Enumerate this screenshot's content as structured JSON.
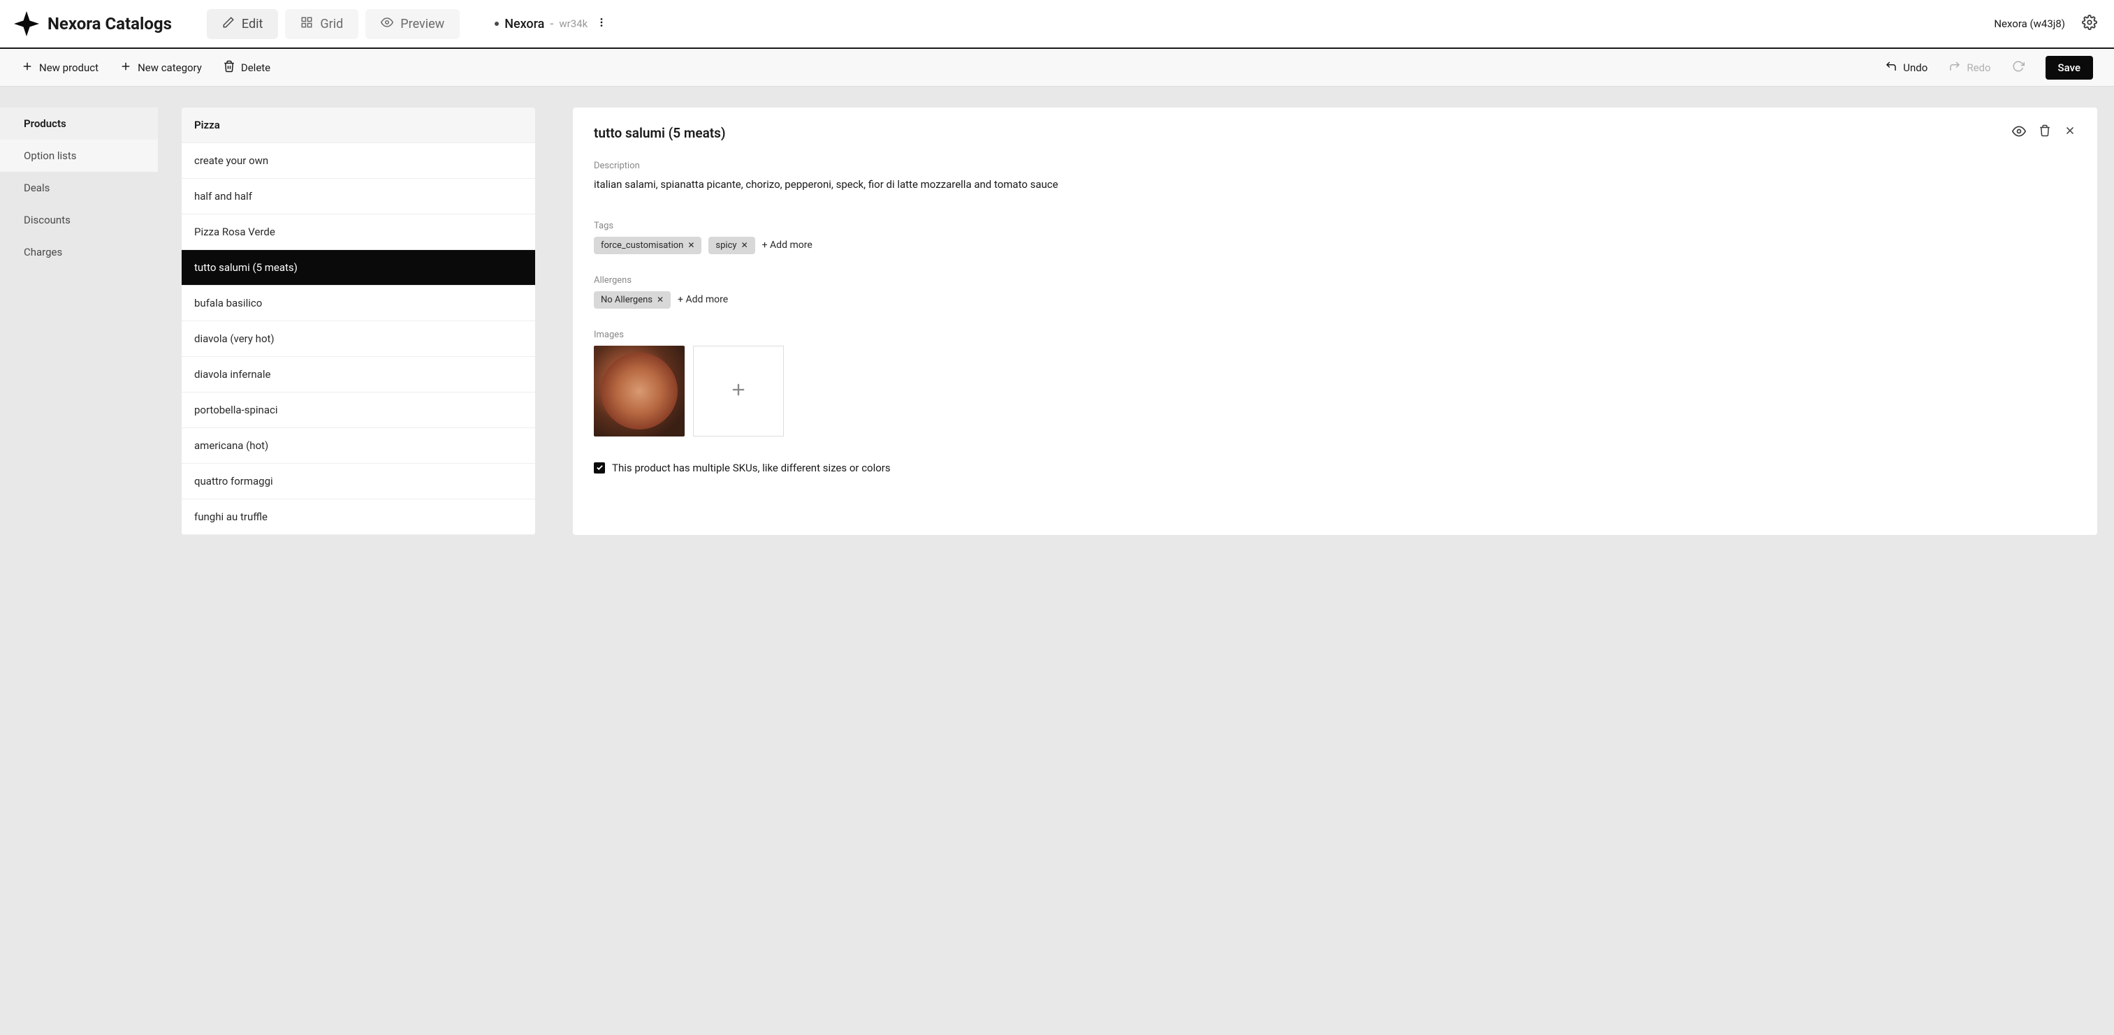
{
  "brand": {
    "name": "Nexora Catalogs"
  },
  "view_tabs": {
    "edit": "Edit",
    "grid": "Grid",
    "preview": "Preview"
  },
  "catalog": {
    "name": "Nexora",
    "id": "wr34k"
  },
  "user": {
    "label": "Nexora (w43j8)"
  },
  "toolbar": {
    "new_product": "New product",
    "new_category": "New category",
    "delete": "Delete",
    "undo": "Undo",
    "redo": "Redo",
    "save": "Save"
  },
  "sidebar": {
    "items": [
      {
        "label": "Products"
      },
      {
        "label": "Option lists"
      },
      {
        "label": "Deals"
      },
      {
        "label": "Discounts"
      },
      {
        "label": "Charges"
      }
    ]
  },
  "product_list": {
    "category": "Pizza",
    "items": [
      "create your own",
      "half and half",
      "Pizza Rosa Verde",
      "tutto salumi (5 meats)",
      "bufala basilico",
      "diavola (very hot)",
      "diavola infernale",
      "portobella-spinaci",
      "americana (hot)",
      "quattro formaggi",
      "funghi au truffle"
    ],
    "selected_index": 3
  },
  "detail": {
    "title": "tutto salumi (5 meats)",
    "labels": {
      "description": "Description",
      "tags": "Tags",
      "allergens": "Allergens",
      "images": "Images"
    },
    "description": "italian salami, spianatta picante, chorizo, pepperoni, speck, fior di latte mozzarella and tomato sauce",
    "tags": [
      "force_customisation",
      "spicy"
    ],
    "allergens": [
      "No Allergens"
    ],
    "add_more": "+ Add more",
    "sku_checkbox_label": "This product has multiple SKUs, like different sizes or colors",
    "sku_checked": true
  }
}
